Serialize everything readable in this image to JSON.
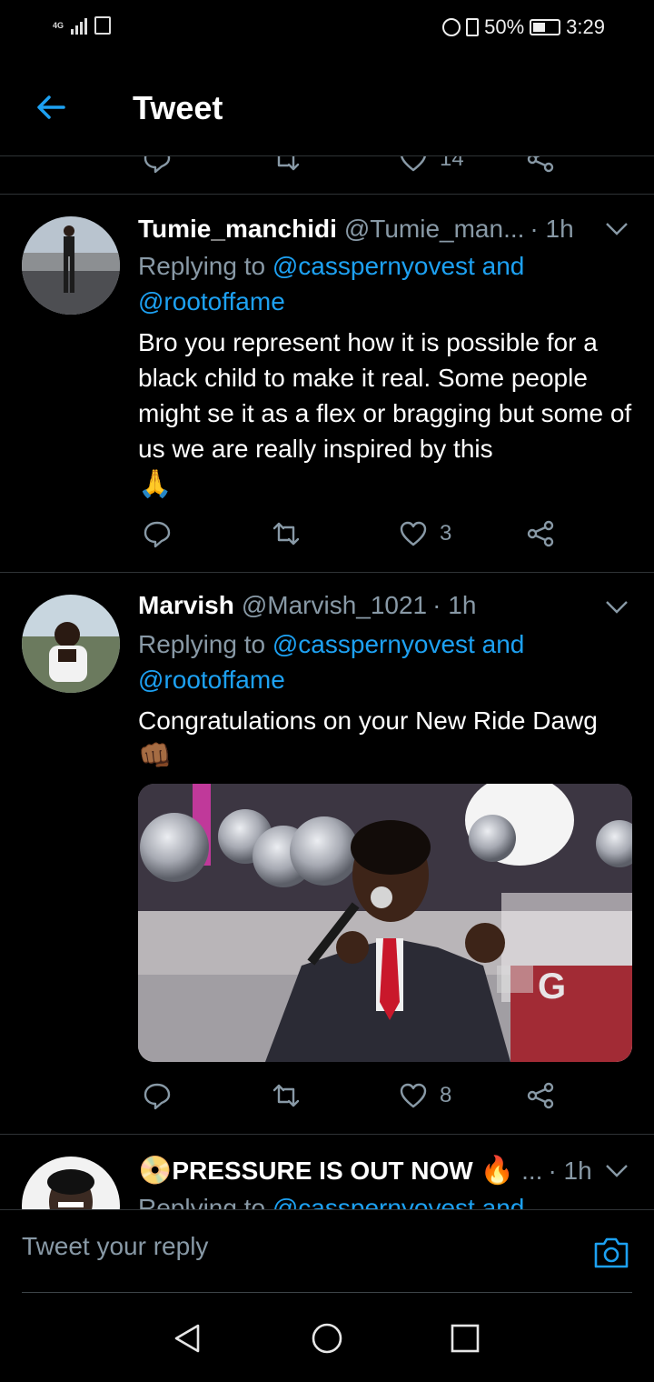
{
  "status_bar": {
    "network": "4G",
    "battery": "50%",
    "battery_level": 0.5,
    "time": "3:29"
  },
  "header": {
    "back_icon": "arrow-left-icon",
    "title": "Tweet"
  },
  "previous_tweet": {
    "like_count": "14"
  },
  "tweets": [
    {
      "name": "Tumie_manchidi",
      "handle": "@Tumie_man...",
      "time": "· 1h",
      "replying_prefix": "Replying to",
      "mention_1": "@casspernyovest",
      "and": "and",
      "mention_2": "@rootoffame",
      "text": "Bro you represent how it is possible for a black child to make it real. Some people might se it as a flex or bragging but some of us we are really inspired by this",
      "emoji": "🙏",
      "like_count": "3"
    },
    {
      "name": "Marvish",
      "handle": "@Marvish_1021",
      "time": "· 1h",
      "replying_prefix": "Replying to",
      "mention_1": "@casspernyovest",
      "and": "and",
      "mention_2": "@rootoffame",
      "text": "Congratulations on your New Ride Dawg",
      "emoji": "👊🏾",
      "like_count": "8",
      "media_letter": "G"
    },
    {
      "name_emoji": "📀",
      "name": "PRESSURE IS OUT NOW",
      "name_fire": "🔥",
      "handle": "...",
      "time": "· 1h",
      "replying_prefix": "Replying to",
      "mention_1": "@casspernyovest",
      "and": "and"
    }
  ],
  "reply_bar": {
    "placeholder": "Tweet your reply",
    "camera_icon": "camera-icon"
  },
  "colors": {
    "background": "#000000",
    "accent": "#1da1f2",
    "muted": "#8899a6",
    "divider": "#2f3336"
  }
}
